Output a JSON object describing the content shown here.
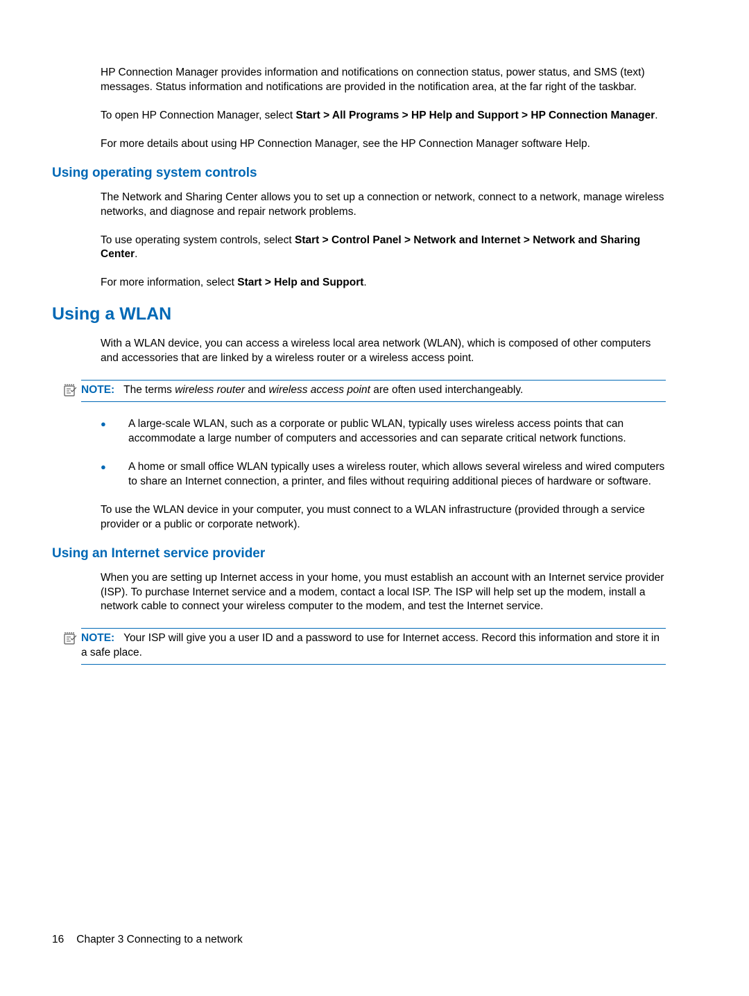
{
  "intro": {
    "p1": "HP Connection Manager provides information and notifications on connection status, power status, and SMS (text) messages. Status information and notifications are provided in the notification area, at the far right of the taskbar.",
    "p2_prefix": "To open HP Connection Manager, select ",
    "p2_bold": "Start > All Programs > HP Help and Support > HP Connection Manager",
    "p2_suffix": ".",
    "p3": "For more details about using HP Connection Manager, see the HP Connection Manager software Help."
  },
  "os_controls": {
    "heading": "Using operating system controls",
    "p1": "The Network and Sharing Center allows you to set up a connection or network, connect to a network, manage wireless networks, and diagnose and repair network problems.",
    "p2_prefix": "To use operating system controls, select ",
    "p2_bold": "Start > Control Panel > Network and Internet > Network and Sharing Center",
    "p2_suffix": ".",
    "p3_prefix": "For more information, select ",
    "p3_bold": "Start > Help and Support",
    "p3_suffix": "."
  },
  "wlan": {
    "heading": "Using a WLAN",
    "p1": "With a WLAN device, you can access a wireless local area network (WLAN), which is composed of other computers and accessories that are linked by a wireless router or a wireless access point.",
    "note_label": "NOTE:",
    "note_prefix": "The terms ",
    "note_italic1": "wireless router",
    "note_mid": " and ",
    "note_italic2": "wireless access point",
    "note_suffix": " are often used interchangeably.",
    "bullet1": "A large-scale WLAN, such as a corporate or public WLAN, typically uses wireless access points that can accommodate a large number of computers and accessories and can separate critical network functions.",
    "bullet2": "A home or small office WLAN typically uses a wireless router, which allows several wireless and wired computers to share an Internet connection, a printer, and files without requiring additional pieces of hardware or software.",
    "p2": "To use the WLAN device in your computer, you must connect to a WLAN infrastructure (provided through a service provider or a public or corporate network)."
  },
  "isp": {
    "heading": "Using an Internet service provider",
    "p1": "When you are setting up Internet access in your home, you must establish an account with an Internet service provider (ISP). To purchase Internet service and a modem, contact a local ISP. The ISP will help set up the modem, install a network cable to connect your wireless computer to the modem, and test the Internet service.",
    "note_label": "NOTE:",
    "note_text": "Your ISP will give you a user ID and a password to use for Internet access. Record this information and store it in a safe place."
  },
  "footer": {
    "page_num": "16",
    "chapter": "Chapter 3   Connecting to a network"
  }
}
